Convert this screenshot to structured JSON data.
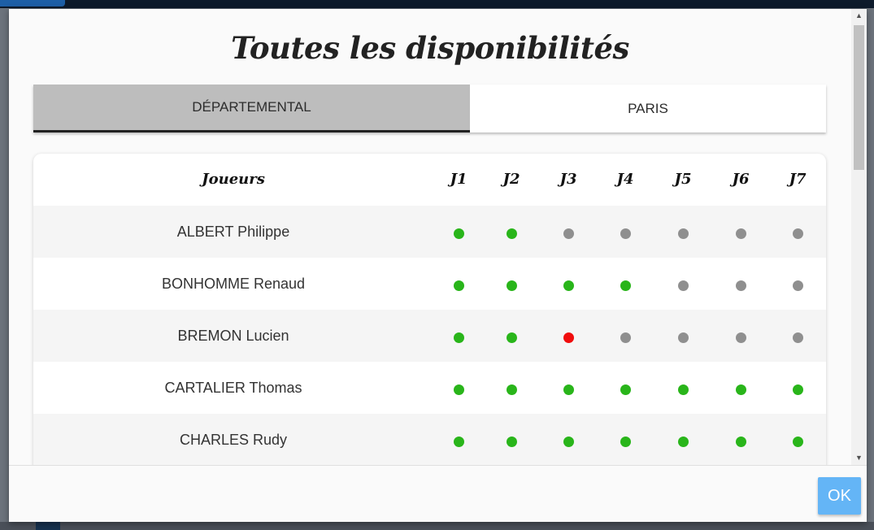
{
  "modal": {
    "title": "Toutes les disponibilités",
    "tabs": [
      {
        "label": "DÉPARTEMENTAL",
        "active": true
      },
      {
        "label": "PARIS",
        "active": false
      }
    ],
    "table": {
      "headers": [
        "Joueurs",
        "J1",
        "J2",
        "J3",
        "J4",
        "J5",
        "J6",
        "J7"
      ],
      "rows": [
        {
          "name": "ALBERT Philippe",
          "status": [
            "available",
            "available",
            "unknown",
            "unknown",
            "unknown",
            "unknown",
            "unknown"
          ]
        },
        {
          "name": "BONHOMME Renaud",
          "status": [
            "available",
            "available",
            "available",
            "available",
            "unknown",
            "unknown",
            "unknown"
          ]
        },
        {
          "name": "BREMON Lucien",
          "status": [
            "available",
            "available",
            "unavailable",
            "unknown",
            "unknown",
            "unknown",
            "unknown"
          ]
        },
        {
          "name": "CARTALIER Thomas",
          "status": [
            "available",
            "available",
            "available",
            "available",
            "available",
            "available",
            "available"
          ]
        },
        {
          "name": "CHARLES Rudy",
          "status": [
            "available",
            "available",
            "available",
            "available",
            "available",
            "available",
            "available"
          ]
        }
      ]
    },
    "footer": {
      "ok_label": "OK"
    }
  },
  "colors": {
    "available": "#29b51a",
    "unknown": "#8f8f8f",
    "unavailable": "#f00d0d",
    "ok_button": "#64b5f6",
    "active_tab": "#bdbdbd"
  },
  "icons": {
    "scroll_up": "triangle-up",
    "scroll_down": "triangle-down"
  }
}
